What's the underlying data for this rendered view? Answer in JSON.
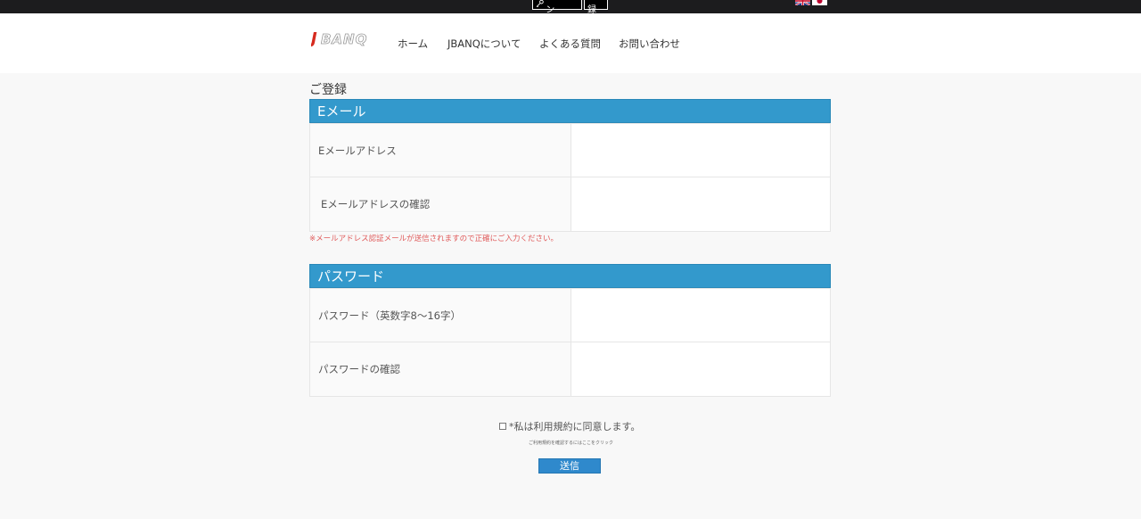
{
  "topbar": {
    "login_label": "ログイン",
    "register_label": "登録",
    "flags": [
      "uk-flag",
      "japan-flag"
    ]
  },
  "header": {
    "logo_text": "JBANQ",
    "nav": [
      "ホーム",
      "JBANQについて",
      "よくある質問",
      "お問い合わせ"
    ]
  },
  "page": {
    "title": "ご登録",
    "email_section": {
      "heading": "Eメール",
      "rows": [
        {
          "label": "Eメールアドレス",
          "value": ""
        },
        {
          "label": "Eメールアドレスの確認",
          "value": ""
        }
      ],
      "notice": "※メールアドレス認証メールが送信されますので正確にご入力ください。"
    },
    "password_section": {
      "heading": "パスワード",
      "rows": [
        {
          "label": "パスワード（英数字8～16字）",
          "value": ""
        },
        {
          "label": "パスワードの確認",
          "value": ""
        }
      ]
    },
    "agree_label": "*私は利用規約に同意します。",
    "terms_link": "ご利用規約を確認するにはここをクリック",
    "submit_label": "送信"
  },
  "colors": {
    "topbar": "#1c1c1e",
    "section_header": "#3399cc",
    "submit": "#2f89cc",
    "notice": "#e05a5a",
    "logo_red": "#d62b1f"
  }
}
